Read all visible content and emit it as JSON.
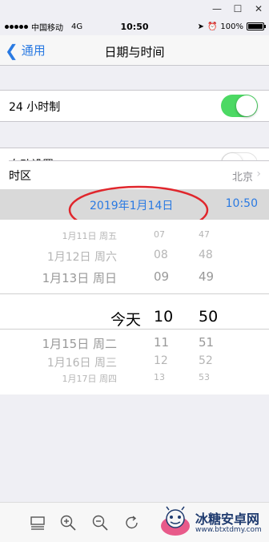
{
  "status_bar": {
    "carrier": "中国移动",
    "network": "4G",
    "time": "10:50",
    "battery": "100%"
  },
  "nav": {
    "back_label": "通用",
    "title": "日期与时间"
  },
  "settings": {
    "hour24": {
      "label": "24 小时制",
      "on": true
    },
    "auto_set": {
      "label": "自动设置",
      "on": false
    },
    "timezone": {
      "label": "时区",
      "value": "北京"
    }
  },
  "selected": {
    "date": "2019年1月14日",
    "time": "10:50"
  },
  "picker": {
    "rows": [
      {
        "date": "1月11日  周五",
        "hour": "07",
        "minute": "47"
      },
      {
        "date": "1月12日  周六",
        "hour": "08",
        "minute": "48"
      },
      {
        "date": "1月13日  周日",
        "hour": "09",
        "minute": "49"
      },
      {
        "date": "今天",
        "hour": "10",
        "minute": "50"
      },
      {
        "date": "1月15日  周二",
        "hour": "11",
        "minute": "51"
      },
      {
        "date": "1月16日  周三",
        "hour": "12",
        "minute": "52"
      },
      {
        "date": "1月17日  周四",
        "hour": "13",
        "minute": "53"
      }
    ]
  },
  "watermark": {
    "title": "冰糖安卓网",
    "url": "www.btxtdmy.com"
  },
  "colors": {
    "accent": "#2a7ae2",
    "toggle_on": "#4cd964",
    "annotation": "#e0262c"
  },
  "icons": [
    "window-minimize-icon",
    "window-maximize-icon",
    "window-close-icon",
    "layout-icon",
    "zoom-in-icon",
    "zoom-out-icon",
    "rotate-icon"
  ]
}
